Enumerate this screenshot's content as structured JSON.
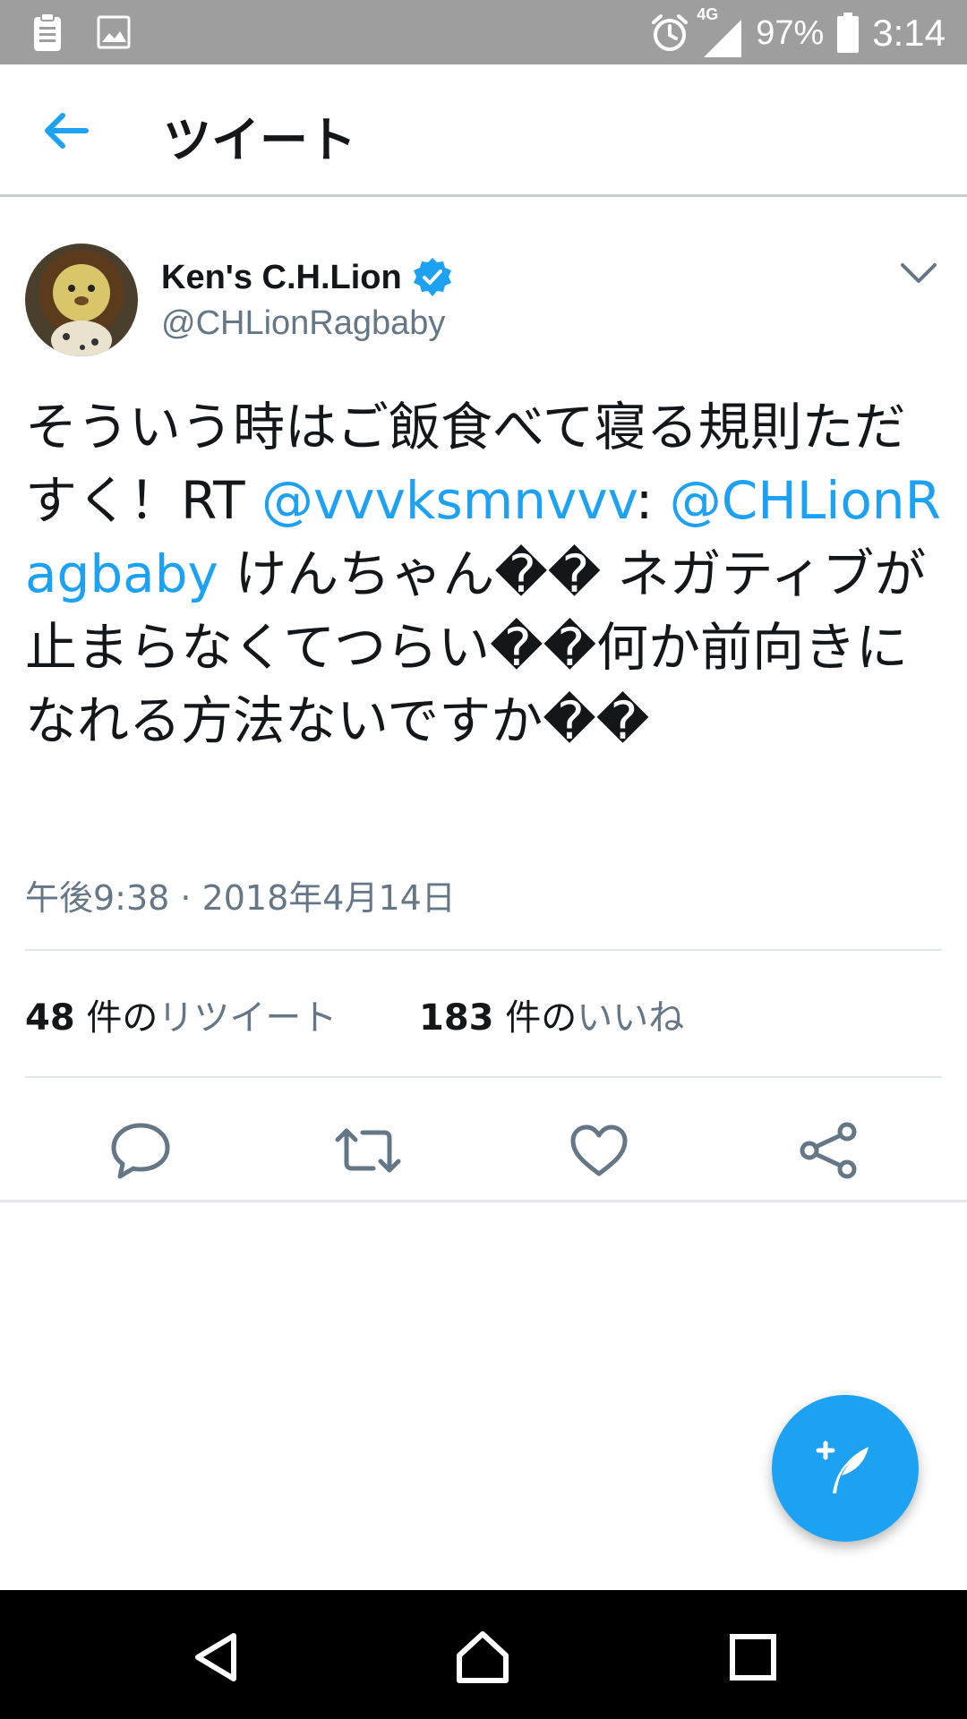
{
  "status_bar": {
    "network": "4G",
    "battery": "97%",
    "time": "3:14"
  },
  "header": {
    "title": "ツイート"
  },
  "tweet": {
    "author_name": "Ken's C.H.Lion",
    "author_handle": "@CHLionRagbaby",
    "text_parts": {
      "p1": "そういう時はご飯食べて寝る規則ただすく！RT ",
      "m1": "@vvvksmnvvv",
      "p2": ": ",
      "m2": "@CHLionRagbaby",
      "p3": " けんちゃん�� ネガティブが止まらなくてつらい��何か前向きになれる方法ないですか��"
    },
    "timestamp": "午後9:38 · 2018年4月14日",
    "retweets": {
      "count": "48",
      "unit": "件の",
      "label": "リツイート"
    },
    "likes": {
      "count": "183",
      "unit": "件の",
      "label": "いいね"
    }
  },
  "colors": {
    "accent": "#1da1f2",
    "secondary_text": "#657786",
    "status_bar": "#9e9e9e"
  },
  "icons": {
    "status_left": [
      "clipboard-icon",
      "image-icon"
    ],
    "status_right": [
      "alarm-icon",
      "signal-icon",
      "battery-icon"
    ],
    "header": [
      "back-arrow-icon"
    ],
    "tweet": [
      "verified-badge-icon",
      "chevron-down-icon"
    ],
    "actions": [
      "reply-icon",
      "retweet-icon",
      "like-icon",
      "share-icon"
    ],
    "fab": "compose-tweet-icon",
    "nav": [
      "nav-back-icon",
      "nav-home-icon",
      "nav-recents-icon"
    ]
  }
}
